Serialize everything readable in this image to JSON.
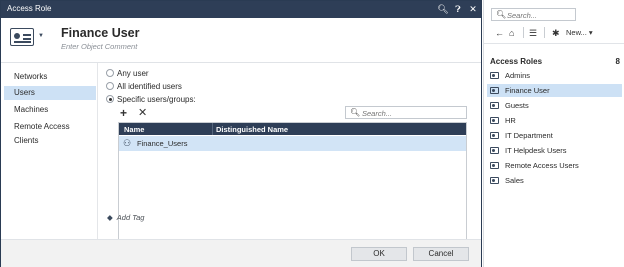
{
  "dialog": {
    "title": "Access Role",
    "object_name": "Finance User",
    "object_comment_placeholder": "Enter Object Comment",
    "nav": [
      "Networks",
      "Users",
      "Machines",
      "Remote Access Clients"
    ],
    "active_nav": "Users",
    "radios": [
      {
        "label": "Any user",
        "selected": false
      },
      {
        "label": "All identified users",
        "selected": false
      },
      {
        "label": "Specific users/groups:",
        "selected": true
      }
    ],
    "search_placeholder": "Search...",
    "table": {
      "columns": [
        "Name",
        "Distinguished Name"
      ],
      "rows": [
        {
          "name": "Finance_Users",
          "distinguished_name": ""
        }
      ]
    },
    "add_tag": "Add Tag",
    "ok_label": "OK",
    "cancel_label": "Cancel"
  },
  "panel": {
    "search_placeholder": "Search...",
    "new_label": "New...",
    "title": "Access Roles",
    "count": "8",
    "items": [
      "Admins",
      "Finance User",
      "Guests",
      "HR",
      "IT Department",
      "IT Helpdesk Users",
      "Remote Access Users",
      "Sales"
    ],
    "selected_item": "Finance User"
  },
  "colors": {
    "titlebar": "#2e3e57",
    "selection": "#cde1f5",
    "table_header": "#2e3e57"
  }
}
